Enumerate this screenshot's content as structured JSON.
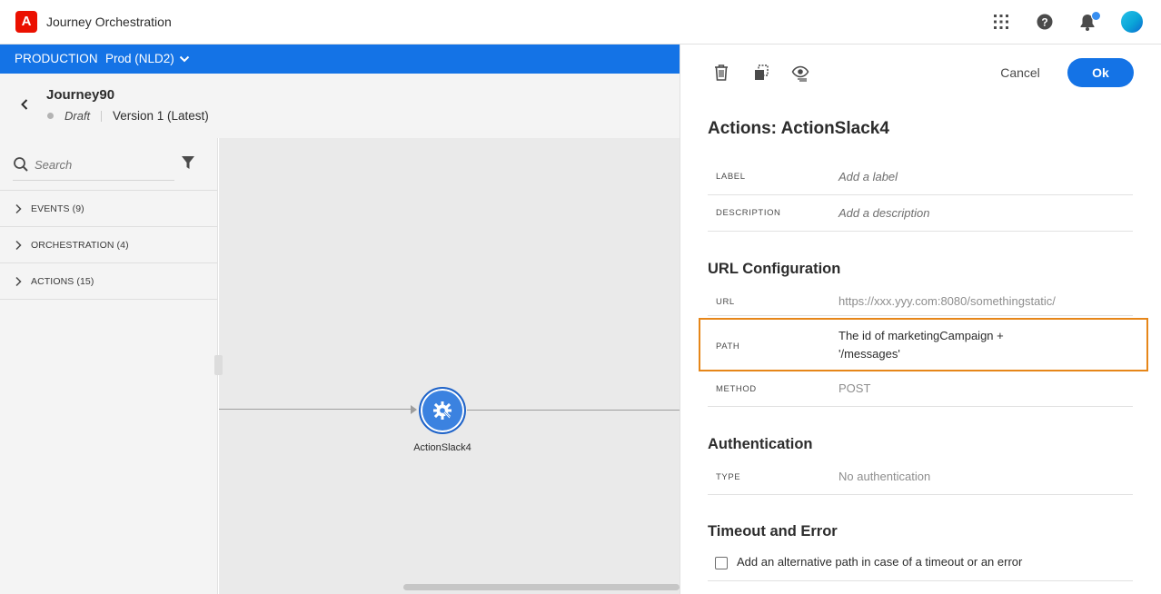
{
  "app": {
    "logo": "A",
    "title": "Journey Orchestration"
  },
  "topbar": {
    "icons": [
      "apps-grid-icon",
      "help-icon",
      "bell-icon",
      "avatar"
    ]
  },
  "env": {
    "name": "PRODUCTION",
    "sandbox": "Prod (NLD2)"
  },
  "journey": {
    "name": "Journey90",
    "status": "Draft",
    "version": "Version 1 (Latest)"
  },
  "palette": {
    "search_placeholder": "Search",
    "categories": [
      {
        "label": "EVENTS (9)"
      },
      {
        "label": "ORCHESTRATION (4)"
      },
      {
        "label": "ACTIONS (15)"
      }
    ]
  },
  "canvas": {
    "node_label": "ActionSlack4"
  },
  "panel": {
    "cancel_label": "Cancel",
    "ok_label": "Ok",
    "title": "Actions: ActionSlack4",
    "label_key": "LABEL",
    "label_placeholder": "Add a label",
    "description_key": "DESCRIPTION",
    "description_placeholder": "Add a description",
    "url_section": "URL Configuration",
    "url_key": "URL",
    "url_value": "https://xxx.yyy.com:8080/somethingstatic/",
    "path_key": "PATH",
    "path_value_line1": "The id of marketingCampaign +",
    "path_value_line2": "'/messages'",
    "method_key": "METHOD",
    "method_value": "POST",
    "auth_section": "Authentication",
    "type_key": "TYPE",
    "type_value": "No authentication",
    "timeout_section": "Timeout and Error",
    "timeout_checkbox_label": "Add an alternative path in case of a timeout or an error"
  },
  "colors": {
    "accent": "#1473e6",
    "highlight": "#e68619",
    "brand": "#eb1000"
  }
}
